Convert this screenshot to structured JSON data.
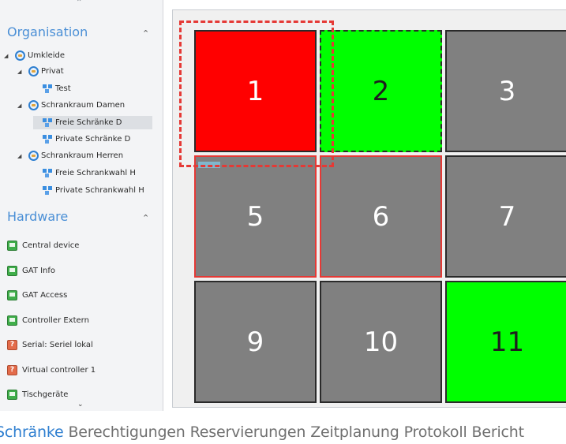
{
  "sidebar": {
    "organisation_header": "Organisation",
    "hardware_header": "Hardware",
    "tree": [
      {
        "label": "Umkleide"
      },
      {
        "label": "Privat"
      },
      {
        "label": "Test"
      },
      {
        "label": "Schrankraum Damen"
      },
      {
        "label": "Freie Schränke D"
      },
      {
        "label": "Private Schränke D"
      },
      {
        "label": "Schrankraum Herren"
      },
      {
        "label": "Freie Schrankwahl H"
      },
      {
        "label": "Private Schrankwahl H"
      }
    ],
    "hardware": [
      {
        "label": "Central device",
        "icon": "device-icon"
      },
      {
        "label": "GAT Info",
        "icon": "device-icon"
      },
      {
        "label": "GAT Access",
        "icon": "device-icon"
      },
      {
        "label": "Controller Extern",
        "icon": "device-icon"
      },
      {
        "label": "Serial: Seriel lokal",
        "icon": "unknown-device-icon"
      },
      {
        "label": "Virtual controller 1",
        "icon": "unknown-device-icon"
      },
      {
        "label": "Tischgeräte",
        "icon": "device-icon"
      }
    ]
  },
  "lockers": [
    {
      "number": "1",
      "status_color": "#ff0000"
    },
    {
      "number": "2",
      "status_color": "#00ff00"
    },
    {
      "number": "3",
      "status_color": "#808080"
    },
    {
      "number": "5",
      "status_color": "#808080"
    },
    {
      "number": "6",
      "status_color": "#808080"
    },
    {
      "number": "7",
      "status_color": "#808080"
    },
    {
      "number": "9",
      "status_color": "#808080"
    },
    {
      "number": "10",
      "status_color": "#808080"
    },
    {
      "number": "11",
      "status_color": "#00ff00"
    }
  ],
  "tabs": [
    {
      "label": "Schränke",
      "active": true
    },
    {
      "label": "Berechtigungen",
      "active": false
    },
    {
      "label": "Reservierungen",
      "active": false
    },
    {
      "label": "Zeitplanung",
      "active": false
    },
    {
      "label": "Protokoll",
      "active": false
    },
    {
      "label": "Bericht",
      "active": false
    }
  ],
  "colors": {
    "accent": "#2f7fd0",
    "selection": "#e53935"
  }
}
